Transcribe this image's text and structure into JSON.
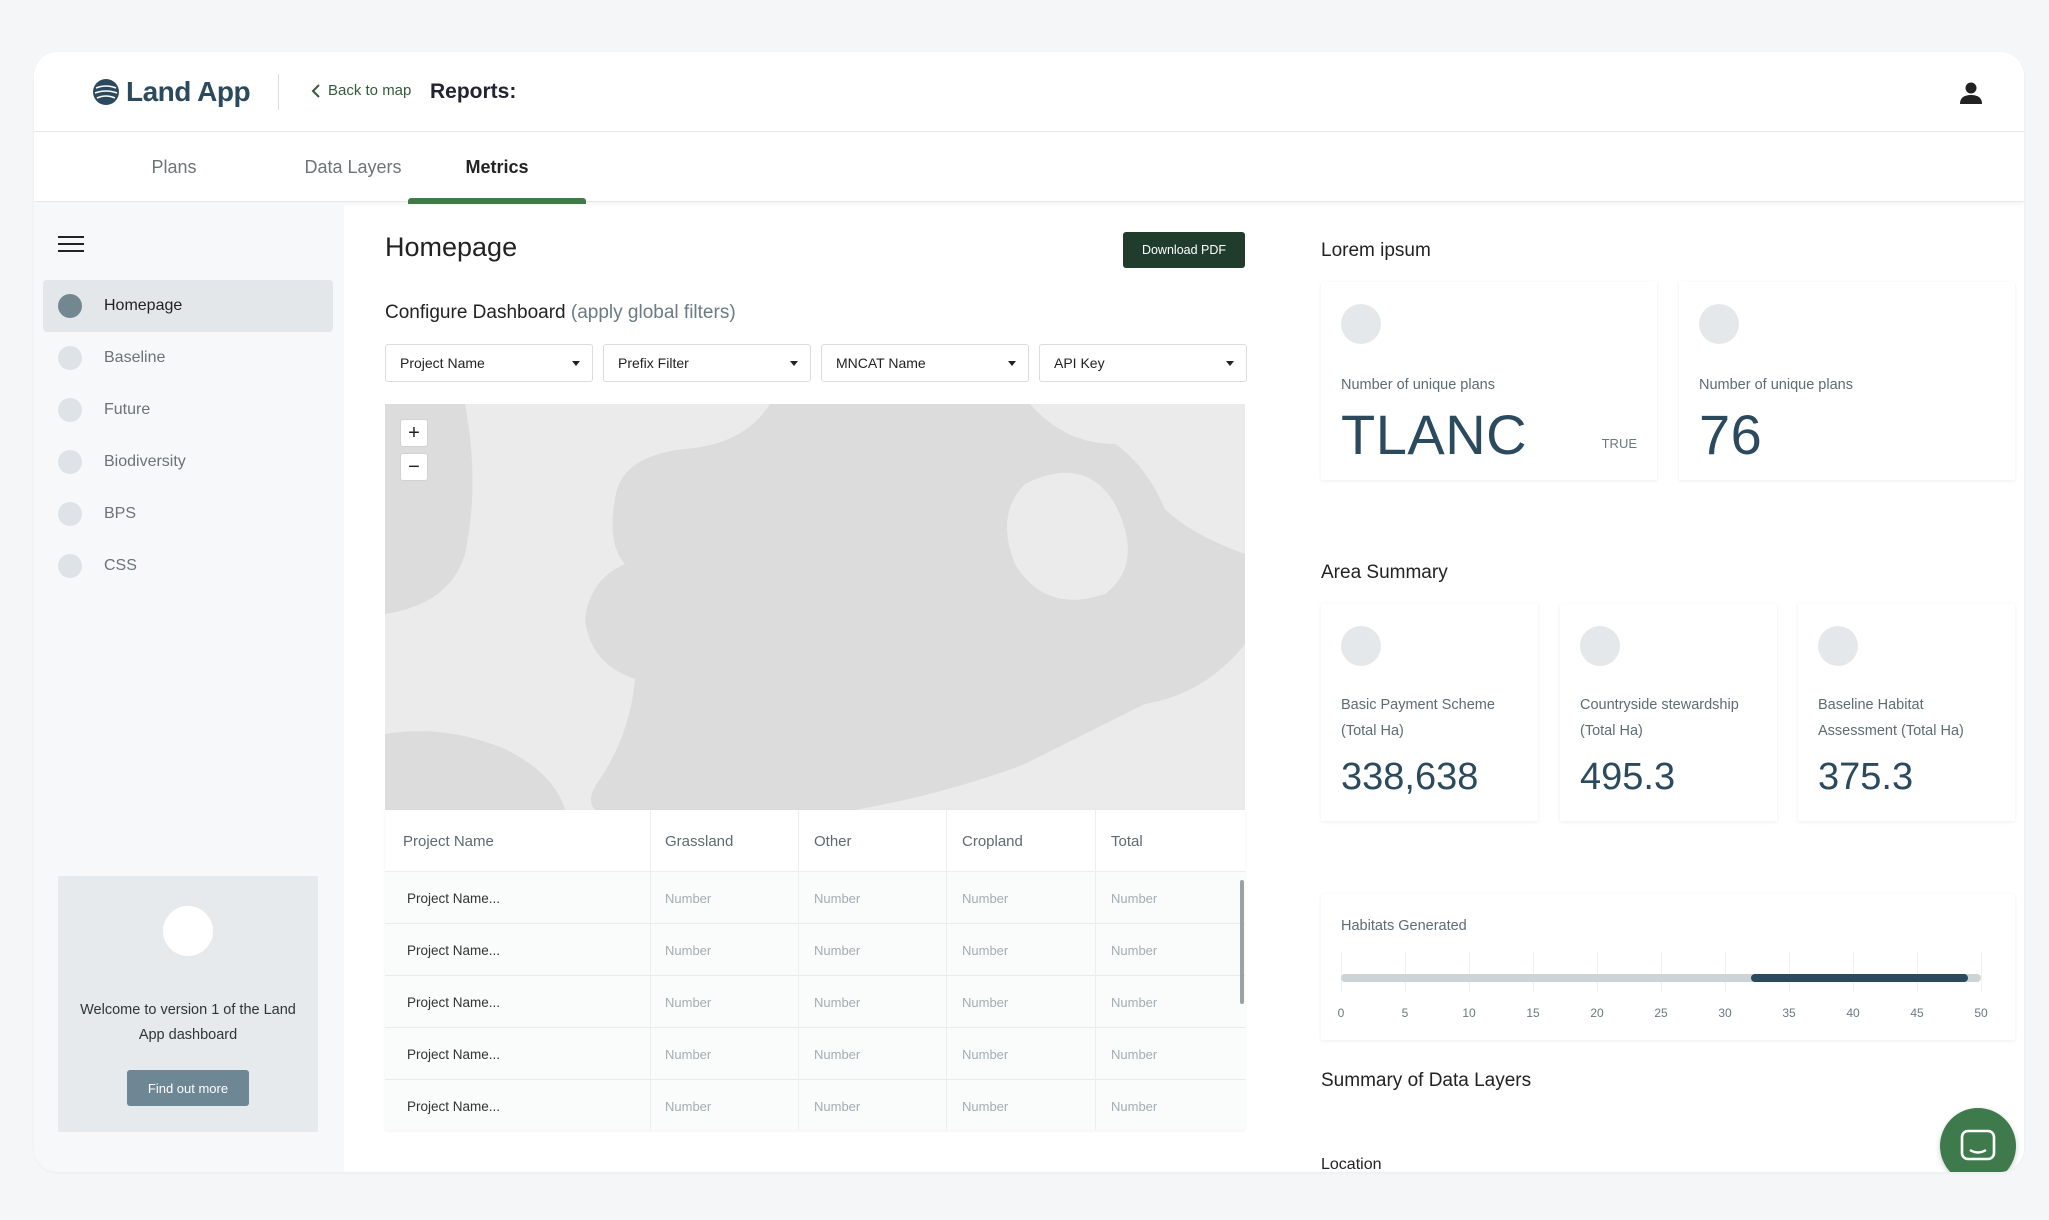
{
  "header": {
    "logo_text": "Land App",
    "back_label": "Back to map",
    "reports_label": "Reports:"
  },
  "tabs": [
    {
      "label": "Plans",
      "active": false
    },
    {
      "label": "Data Layers",
      "active": false
    },
    {
      "label": "Metrics",
      "active": true
    }
  ],
  "sidebar": {
    "items": [
      {
        "label": "Homepage",
        "active": true
      },
      {
        "label": "Baseline",
        "active": false
      },
      {
        "label": "Future",
        "active": false
      },
      {
        "label": "Biodiversity",
        "active": false
      },
      {
        "label": "BPS",
        "active": false
      },
      {
        "label": "CSS",
        "active": false
      }
    ],
    "welcome": {
      "text": "Welcome to version 1 of  the Land App dashboard",
      "button": "Find out more"
    }
  },
  "main": {
    "title": "Homepage",
    "download_label": "Download PDF",
    "configure_title": "Configure Dashboard",
    "configure_hint": "(apply global filters)",
    "filters": [
      "Project Name",
      "Prefix Filter",
      "MNCAT Name",
      "API Key"
    ],
    "map": {
      "zoom_in": "+",
      "zoom_out": "−"
    },
    "table": {
      "columns": [
        "Project Name",
        "Grassland",
        "Other",
        "Cropland",
        "Total"
      ],
      "rows": [
        [
          "Project Name...",
          "Number",
          "Number",
          "Number",
          "Number"
        ],
        [
          "Project Name...",
          "Number",
          "Number",
          "Number",
          "Number"
        ],
        [
          "Project Name...",
          "Number",
          "Number",
          "Number",
          "Number"
        ],
        [
          "Project Name...",
          "Number",
          "Number",
          "Number",
          "Number"
        ],
        [
          "Project Name...",
          "Number",
          "Number",
          "Number",
          "Number"
        ]
      ]
    }
  },
  "right": {
    "lorem_title": "Lorem ipsum",
    "lorem_cards": [
      {
        "label": "Number of unique plans",
        "value": "TLANC",
        "badge": "TRUE"
      },
      {
        "label": "Number of unique plans",
        "value": "76"
      }
    ],
    "area_title": "Area Summary",
    "area_cards": [
      {
        "label": "Basic Payment Scheme (Total Ha)",
        "value": "338,638"
      },
      {
        "label": "Countryside stewardship (Total Ha)",
        "value": "495.3"
      },
      {
        "label": "Baseline Habitat Assessment (Total Ha)",
        "value": "375.3"
      }
    ],
    "habitats": {
      "title": "Habitats Generated",
      "ticks": [
        "0",
        "5",
        "10",
        "15",
        "20",
        "25",
        "30",
        "35",
        "40",
        "45",
        "50"
      ],
      "range_start": 32,
      "range_end": 49,
      "max": 50
    },
    "summary_title": "Summary of Data Layers",
    "location_label": "Location"
  },
  "colors": {
    "accent_green": "#3f7a47",
    "dark_green": "#203c2c",
    "slate": "#2c4a5e"
  }
}
